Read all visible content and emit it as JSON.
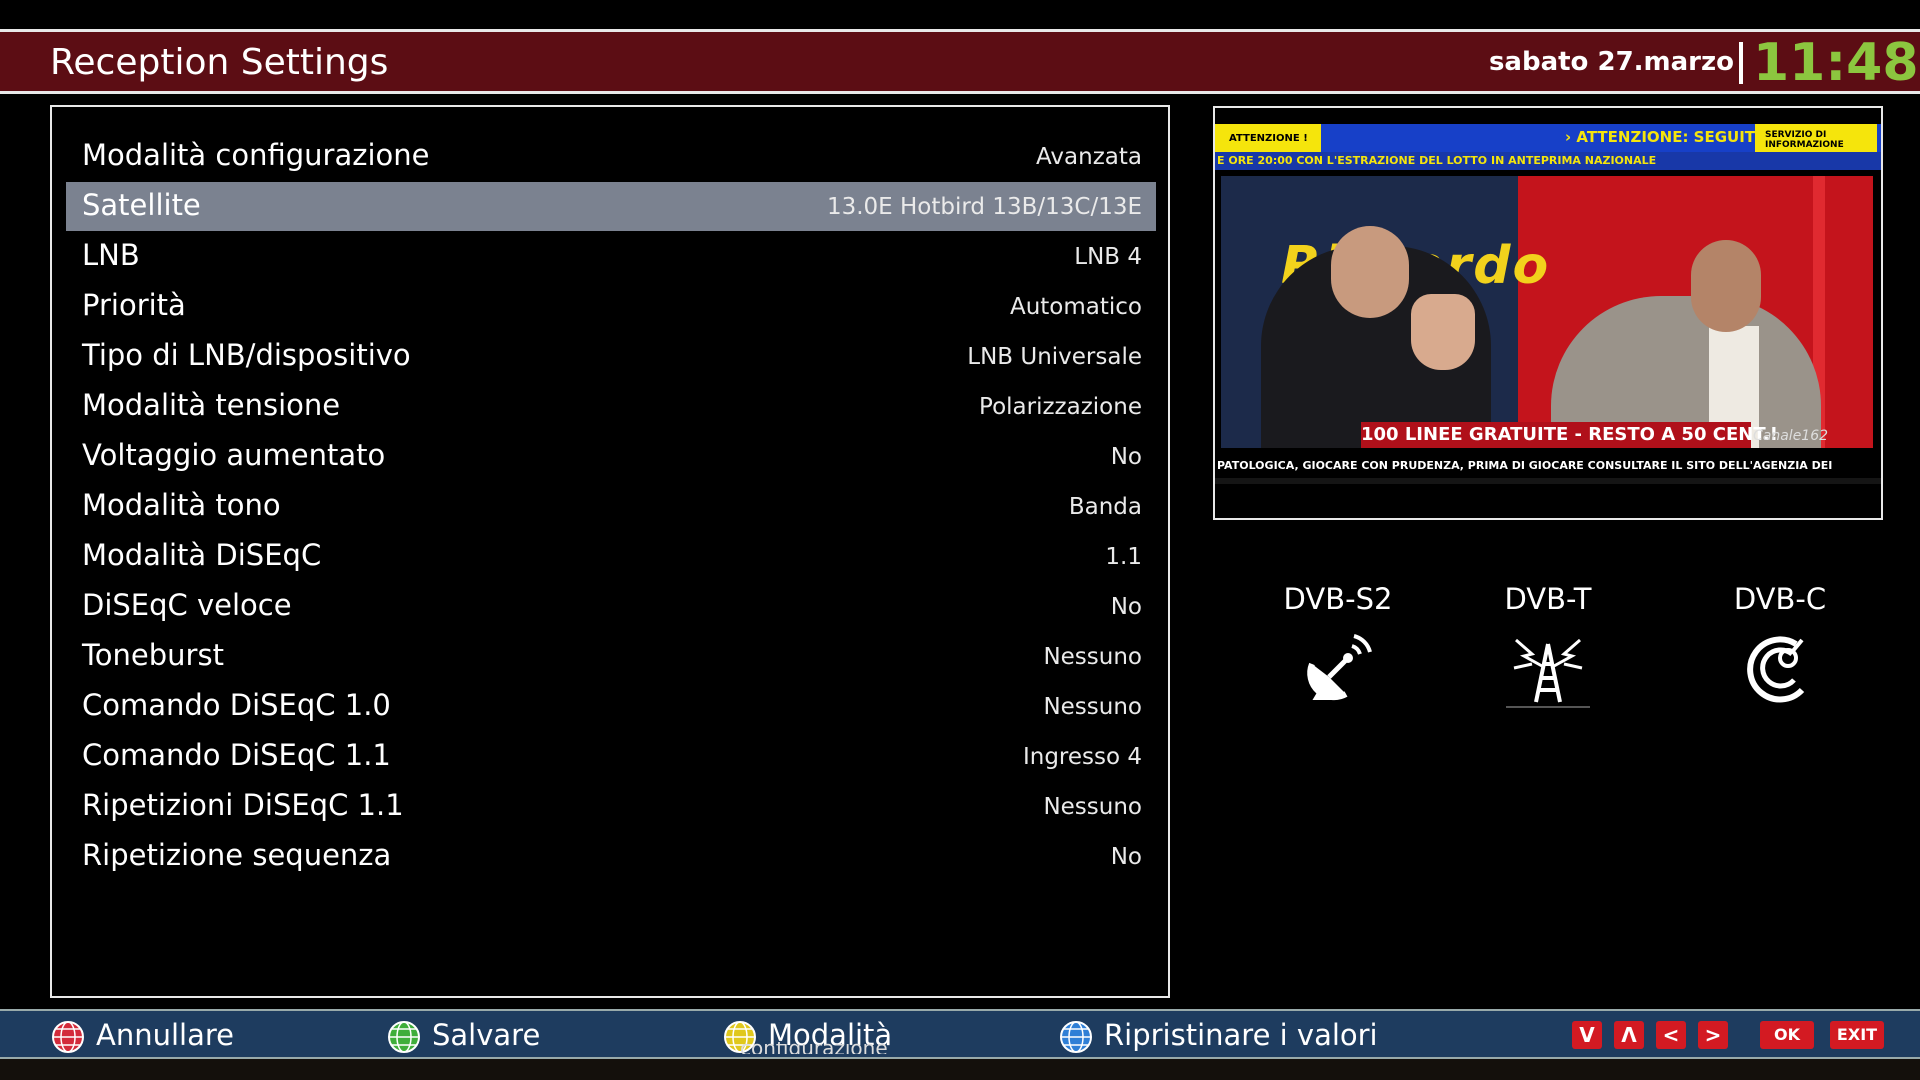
{
  "header": {
    "title": "Reception Settings",
    "date": "sabato 27.marzo",
    "time": "11:48"
  },
  "settings": {
    "rows": [
      {
        "label": "Modalità configurazione",
        "value": "Avanzata"
      },
      {
        "label": "Satellite",
        "value": "13.0E Hotbird 13B/13C/13E",
        "selected": true
      },
      {
        "label": "LNB",
        "value": "LNB 4"
      },
      {
        "label": "Priorità",
        "value": "Automatico"
      },
      {
        "label": "Tipo di LNB/dispositivo",
        "value": "LNB Universale"
      },
      {
        "label": "Modalità tensione",
        "value": "Polarizzazione"
      },
      {
        "label": "Voltaggio aumentato",
        "value": "No"
      },
      {
        "label": "Modalità tono",
        "value": "Banda"
      },
      {
        "label": "Modalità DiSEqC",
        "value": "1.1"
      },
      {
        "label": "DiSEqC veloce",
        "value": "No"
      },
      {
        "label": "Toneburst",
        "value": "Nessuno"
      },
      {
        "label": "Comando DiSEqC 1.0",
        "value": "Nessuno"
      },
      {
        "label": "Comando DiSEqC 1.1",
        "value": "Ingresso 4"
      },
      {
        "label": "Ripetizioni DiSEqC 1.1",
        "value": "Nessuno"
      },
      {
        "label": "Ripetizione sequenza",
        "value": "No"
      }
    ]
  },
  "preview": {
    "top_left_badge": "ATTENZIONE !",
    "top_right_badge": "SERVIZIO DI INFORMAZIONE",
    "top_text": "› ATTENZIONE: SEGUITE LE",
    "ticker_top": "E ORE 20:00 CON L'ESTRAZIONE DEL LOTTO IN ANTEPRIMA NAZIONALE",
    "logo_text": "Riccardo",
    "banner": "100 LINEE GRATUITE - RESTO A 50 CENT.!",
    "channel": "Canale162",
    "ticker_bottom": "PATOLOGICA, GIOCARE CON PRUDENZA, PRIMA DI GIOCARE CONSULTARE IL SITO DELL'AGENZIA DEI"
  },
  "tuners": [
    {
      "label": "DVB-S2",
      "icon": "satellite-dish-icon"
    },
    {
      "label": "DVB-T",
      "icon": "antenna-tower-icon"
    },
    {
      "label": "DVB-C",
      "icon": "cable-icon"
    }
  ],
  "footer": {
    "buttons": [
      {
        "label": "Annullare",
        "color": "#d32a3a"
      },
      {
        "label": "Salvare",
        "color": "#3fae3a"
      },
      {
        "label": "Modalità",
        "color": "#e0c81c"
      },
      {
        "label": "Ripristinare i valori",
        "color": "#2f7fd6"
      }
    ],
    "modalita_sub": "configurazione",
    "nav_keys": [
      "V",
      "Λ",
      "<",
      ">"
    ],
    "ok_label": "OK",
    "exit_label": "EXIT"
  },
  "colors": {
    "header_bg": "#5c0d14",
    "time_color": "#8cc63f",
    "selected_row": "#7b8290",
    "footer_bg": "#1e3c5f",
    "key_red": "#d31a22"
  }
}
